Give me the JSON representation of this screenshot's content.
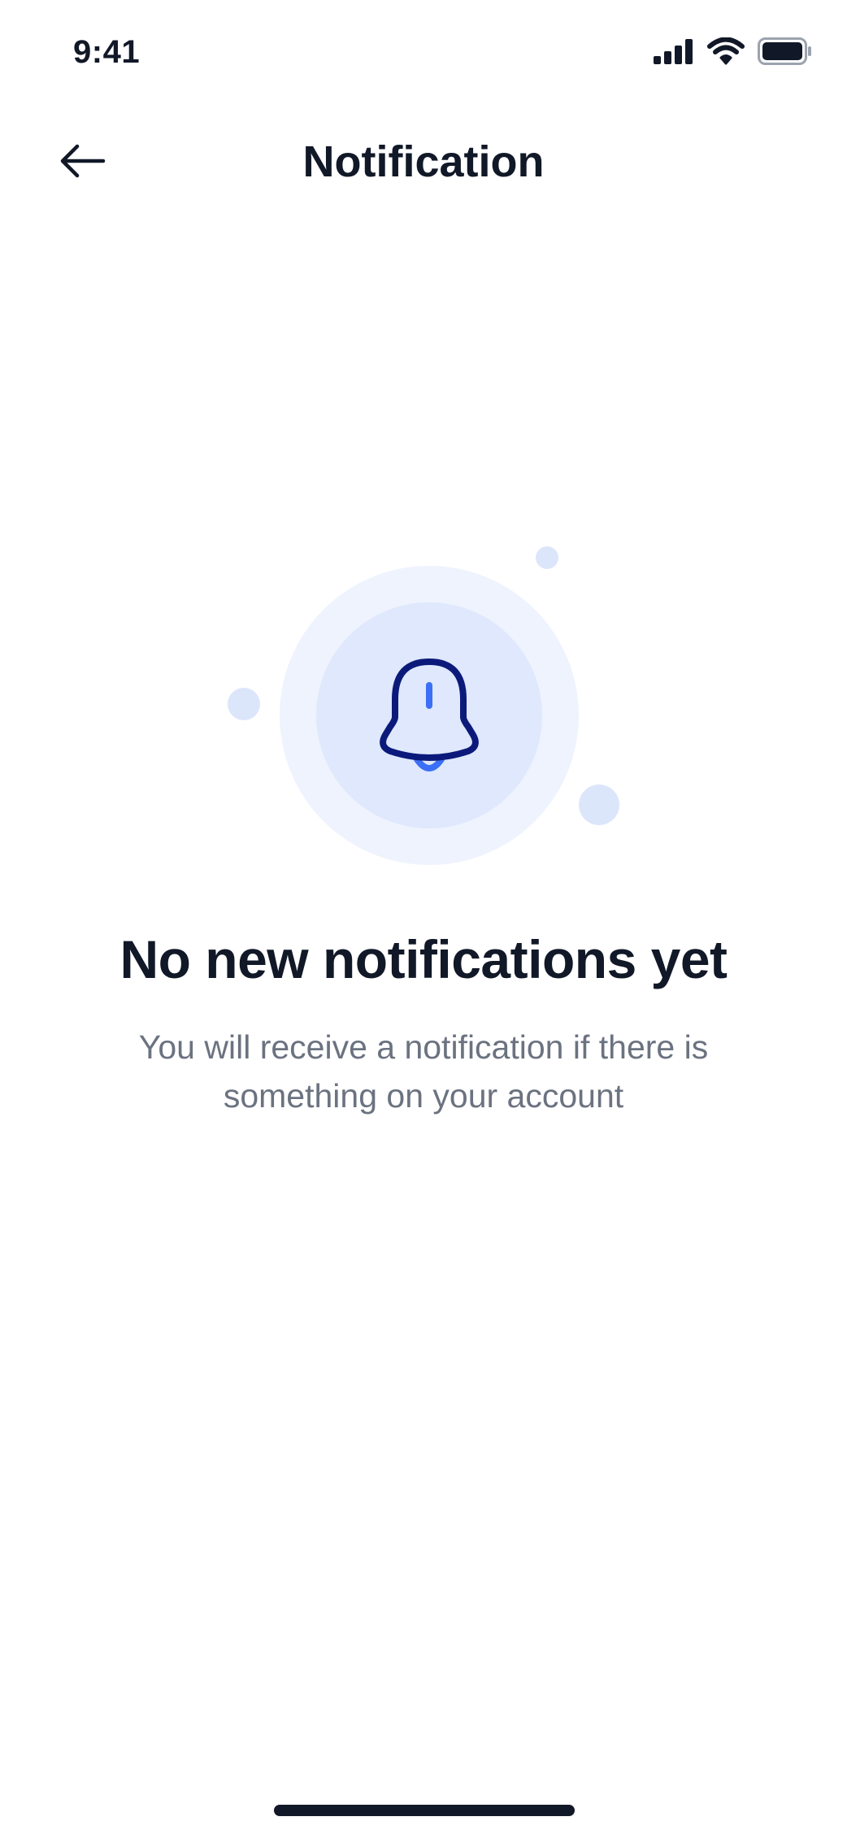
{
  "status_bar": {
    "time": "9:41",
    "icons": [
      "cellular-signal-icon",
      "wifi-icon",
      "battery-icon"
    ]
  },
  "header": {
    "back_icon": "arrow-left-icon",
    "title": "Notification"
  },
  "empty_state": {
    "icon": "bell-icon",
    "title": "No new notifications yet",
    "description": "You will receive a notification if there is something on your account"
  },
  "colors": {
    "text_primary": "#111827",
    "text_secondary": "#6b7280",
    "circle_outer": "#eef3fe",
    "circle_inner": "#dfe8fc",
    "dots": "#dce6fb",
    "bell_outline": "#0b1a7a",
    "bell_accent": "#3b6ff5"
  }
}
